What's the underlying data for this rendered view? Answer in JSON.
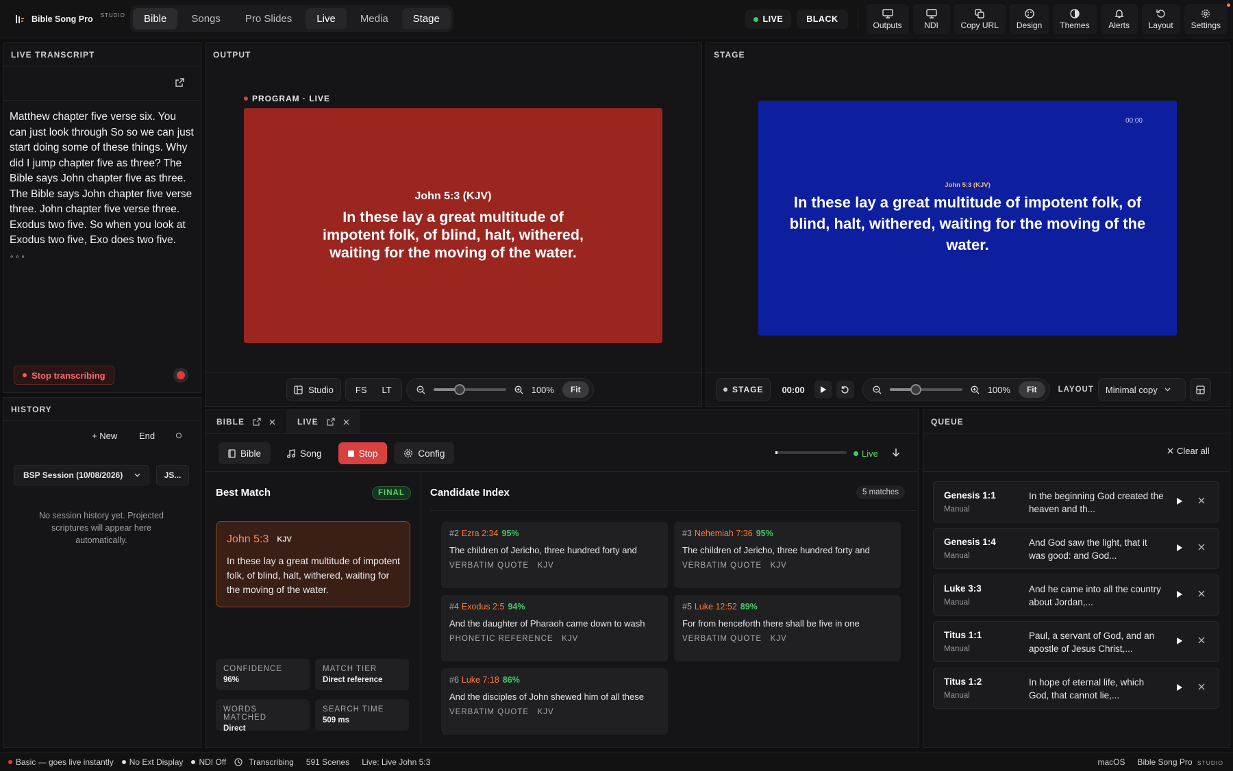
{
  "app": {
    "name": "Bible Song Pro",
    "edition": "STUDIO"
  },
  "nav": {
    "tabs": [
      {
        "label": "Bible"
      },
      {
        "label": "Songs"
      },
      {
        "label": "Pro Slides"
      },
      {
        "label": "Live"
      },
      {
        "label": "Media"
      },
      {
        "label": "Stage"
      }
    ]
  },
  "top": {
    "live_label": "LIVE",
    "black_label": "BLACK",
    "tools": [
      {
        "label": "Outputs",
        "icon": "monitor-icon"
      },
      {
        "label": "NDI",
        "icon": "ndi-monitor-icon"
      },
      {
        "label": "Copy URL",
        "icon": "copy-icon"
      },
      {
        "label": "Design",
        "icon": "palette-icon"
      },
      {
        "label": "Themes",
        "icon": "theme-icon"
      },
      {
        "label": "Alerts",
        "icon": "bell-icon"
      },
      {
        "label": "Layout",
        "icon": "undo-icon"
      },
      {
        "label": "Settings",
        "icon": "gear-icon"
      }
    ]
  },
  "transcript": {
    "title": "LIVE TRANSCRIPT",
    "text": "Matthew chapter five verse six. You can just look through So so we can just start doing some of these things. Why did I jump chapter five as three? The Bible says John chapter five as three. The Bible says John chapter five verse three. John chapter five verse three. Exodus two five. So when you look at Exodus two five, Exo does two five.",
    "stop_label": "Stop transcribing"
  },
  "history": {
    "title": "HISTORY",
    "new_label": "+ New",
    "end_label": "End",
    "session_label": "BSP Session (10/08/2026)",
    "js_label": "JS...",
    "empty_text": "No session history yet. Projected scriptures will appear here automatically."
  },
  "output": {
    "title": "OUTPUT",
    "program_label": "PROGRAM · LIVE",
    "slide_ref": "John 5:3 (KJV)",
    "slide_text": "In these lay a great multitude of impotent folk, of blind, halt, withered, waiting for the moving of the water.",
    "slide_bg": "#9b2620",
    "studio_label": "Studio",
    "fs_label": "FS",
    "lt_label": "LT",
    "zoom": "100%",
    "fit_label": "Fit"
  },
  "stage": {
    "title": "STAGE",
    "timer": "00:00",
    "slide_ref": "John 5:3 (KJV)",
    "slide_text": "In these lay a great multitude of impotent folk, of blind, halt, withered, waiting for the moving of the water.",
    "slide_bg": "#0d1f9e",
    "stage_label": "STAGE",
    "ctrl_timer": "00:00",
    "zoom": "100%",
    "fit_label": "Fit",
    "layout_label": "LAYOUT",
    "layout_value": "Minimal copy"
  },
  "bottom": {
    "tabs": [
      {
        "label": "BIBLE"
      },
      {
        "label": "LIVE"
      }
    ],
    "bible_btn": "Bible",
    "song_btn": "Song",
    "stop_btn": "Stop",
    "config_btn": "Config",
    "live_status": "Live"
  },
  "best_match": {
    "title": "Best Match",
    "badge": "FINAL",
    "ref": "John 5:3",
    "version": "KJV",
    "text": "In these lay a great multitude of impotent folk, of blind, halt, withered, waiting for the moving of the water.",
    "stats": [
      {
        "label": "CONFIDENCE",
        "value": "96%"
      },
      {
        "label": "MATCH TIER",
        "value": "Direct reference"
      },
      {
        "label": "WORDS MATCHED",
        "value": "Direct"
      },
      {
        "label": "SEARCH TIME",
        "value": "509 ms"
      }
    ]
  },
  "candidates": {
    "title": "Candidate Index",
    "count": "5 matches",
    "items": [
      {
        "num": "#2",
        "ref": "Ezra 2:34",
        "pct": "95%",
        "text": "The children of Jericho, three hundred forty and",
        "meta": "VERBATIM QUOTE   KJV"
      },
      {
        "num": "#3",
        "ref": "Nehemiah 7:36",
        "pct": "95%",
        "text": "The children of Jericho, three hundred forty and",
        "meta": "VERBATIM QUOTE   KJV"
      },
      {
        "num": "#4",
        "ref": "Exodus 2:5",
        "pct": "94%",
        "text": "And the daughter of Pharaoh came down to wash",
        "meta": "PHONETIC REFERENCE   KJV"
      },
      {
        "num": "#5",
        "ref": "Luke 12:52",
        "pct": "89%",
        "text": "For from henceforth there shall be five in one",
        "meta": "VERBATIM QUOTE   KJV"
      },
      {
        "num": "#6",
        "ref": "Luke 7:18",
        "pct": "86%",
        "text": "And the disciples of John shewed him of all these",
        "meta": "VERBATIM QUOTE   KJV"
      }
    ]
  },
  "queue": {
    "title": "QUEUE",
    "clear_label": "Clear all",
    "items": [
      {
        "ref": "Genesis 1:1",
        "source": "Manual",
        "text": "In the beginning God created the heaven and th..."
      },
      {
        "ref": "Genesis 1:4",
        "source": "Manual",
        "text": "And God saw the light, that it was good: and God..."
      },
      {
        "ref": "Luke 3:3",
        "source": "Manual",
        "text": "And he came into all the country about Jordan,..."
      },
      {
        "ref": "Titus 1:1",
        "source": "Manual",
        "text": "Paul, a servant of God, and an apostle of Jesus Christ,..."
      },
      {
        "ref": "Titus 1:2",
        "source": "Manual",
        "text": "In hope of eternal life, which God, that cannot lie,..."
      }
    ]
  },
  "status": {
    "items": [
      {
        "label": "Basic — goes live instantly"
      },
      {
        "label": "No Ext Display"
      },
      {
        "label": "NDI Off"
      },
      {
        "label": "Transcribing"
      },
      {
        "label": "591 Scenes"
      },
      {
        "label": "Live: Live John 5:3"
      }
    ],
    "os": "macOS",
    "app": "Bible Song Pro",
    "edition": "STUDIO"
  },
  "colors": {
    "accent_red": "#d94040",
    "live_green": "#3ecf5a",
    "ref_orange": "#ff7a3d",
    "pct_green": "#4cc46b"
  }
}
